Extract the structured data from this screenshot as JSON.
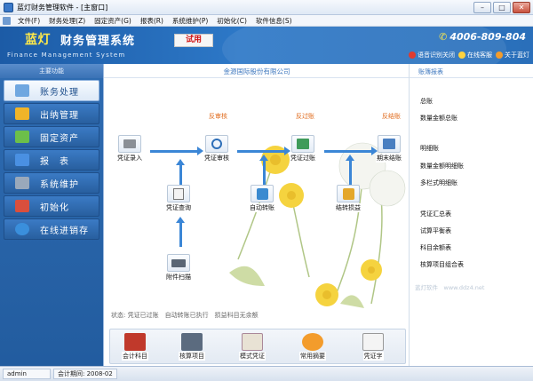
{
  "window": {
    "title": "蓝灯财务管理软件 - [主窗口]"
  },
  "menu": [
    "文件(F)",
    "财务处理(Z)",
    "固定资产(G)",
    "报表(R)",
    "系统维护(P)",
    "初始化(C)",
    "软件信息(S)"
  ],
  "header": {
    "brand": "蓝灯",
    "title": "财务管理系统",
    "subtitle": "Finance Management System",
    "trial": "试用",
    "phone": "4006-809-804",
    "links": [
      "语音识别关闭",
      "在线客服",
      "关于蓝灯"
    ]
  },
  "sidebar": {
    "heading": "主要功能",
    "items": [
      {
        "label": "账务处理",
        "color": "#6fa7e0"
      },
      {
        "label": "出纳管理",
        "color": "#f0b429"
      },
      {
        "label": "固定资产",
        "color": "#6cbf4a"
      },
      {
        "label": "报　表",
        "color": "#4a90e2"
      },
      {
        "label": "系统维护",
        "color": "#9aa9bb"
      },
      {
        "label": "初始化",
        "color": "#d94f3d"
      },
      {
        "label": "在线进销存",
        "color": "#3a8fdc"
      }
    ]
  },
  "main": {
    "company": "金源国际股份有限公司",
    "flow": {
      "voucher_entry": "凭证录入",
      "voucher_audit": "凭证审核",
      "voucher_post": "凭证过账",
      "period_close": "期末结账",
      "voucher_query": "凭证查询",
      "auto_transfer": "自动转账",
      "carry_profit": "结转损益",
      "attachment_scan": "附件扫描",
      "tag_audit": "反审核",
      "tag_post": "反过账",
      "tag_close": "反结账"
    },
    "status": "状态: 凭证已过账　自动转账已执行　损益科目无余额",
    "quick": [
      "会计科目",
      "核算项目",
      "模式凭证",
      "常用摘要",
      "凭证字"
    ]
  },
  "reports": {
    "heading": "账簿报表",
    "items": [
      "总账",
      "数量金额总账",
      "明细账",
      "数量金额明细账",
      "多栏式明细账",
      "凭证汇总表",
      "试算平衡表",
      "科目余额表",
      "核算项目组合表"
    ],
    "watermark": "蓝灯软件　www.ddz4.net"
  },
  "statusbar": {
    "user": "admin",
    "period_label": "会计期间:",
    "period": "2008-02"
  }
}
